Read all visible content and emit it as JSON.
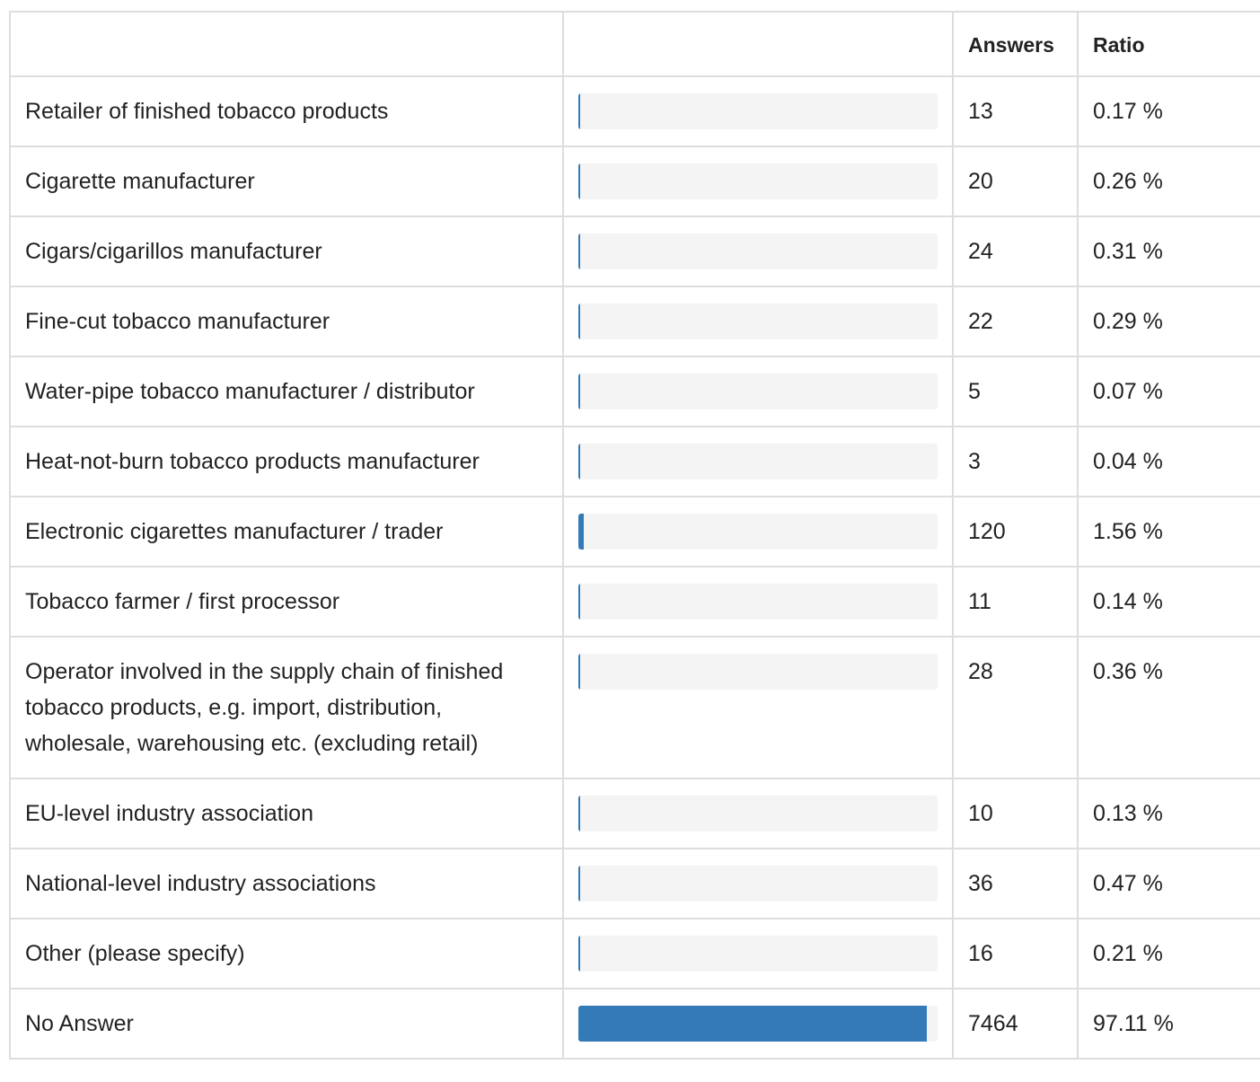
{
  "header": {
    "col_label": "",
    "col_bar": "",
    "col_answers": "Answers",
    "col_ratio": "Ratio"
  },
  "colors": {
    "bar_fill": "#337ab7",
    "bar_track": "#f4f4f4",
    "border": "#dddddd"
  },
  "rows": [
    {
      "label": "Retailer of finished tobacco products",
      "answers": "13",
      "ratio": "0.17 %",
      "ratio_value": 0.17
    },
    {
      "label": "Cigarette manufacturer",
      "answers": "20",
      "ratio": "0.26 %",
      "ratio_value": 0.26
    },
    {
      "label": "Cigars/cigarillos manufacturer",
      "answers": "24",
      "ratio": "0.31 %",
      "ratio_value": 0.31
    },
    {
      "label": "Fine-cut tobacco manufacturer",
      "answers": "22",
      "ratio": "0.29 %",
      "ratio_value": 0.29
    },
    {
      "label": "Water-pipe tobacco manufacturer / distributor",
      "answers": "5",
      "ratio": "0.07 %",
      "ratio_value": 0.07
    },
    {
      "label": "Heat-not-burn tobacco products manufacturer",
      "answers": "3",
      "ratio": "0.04 %",
      "ratio_value": 0.04
    },
    {
      "label": "Electronic cigarettes manufacturer / trader",
      "answers": "120",
      "ratio": "1.56 %",
      "ratio_value": 1.56
    },
    {
      "label": "Tobacco farmer / first processor",
      "answers": "11",
      "ratio": "0.14 %",
      "ratio_value": 0.14
    },
    {
      "label": "Operator involved in the supply chain of finished tobacco products, e.g. import, distribution, wholesale, warehousing etc. (excluding retail)",
      "answers": "28",
      "ratio": "0.36 %",
      "ratio_value": 0.36
    },
    {
      "label": "EU-level industry association",
      "answers": "10",
      "ratio": "0.13 %",
      "ratio_value": 0.13
    },
    {
      "label": "National-level industry associations",
      "answers": "36",
      "ratio": "0.47 %",
      "ratio_value": 0.47
    },
    {
      "label": "Other (please specify)",
      "answers": "16",
      "ratio": "0.21 %",
      "ratio_value": 0.21
    },
    {
      "label": "No Answer",
      "answers": "7464",
      "ratio": "97.11 %",
      "ratio_value": 97.11
    }
  ]
}
